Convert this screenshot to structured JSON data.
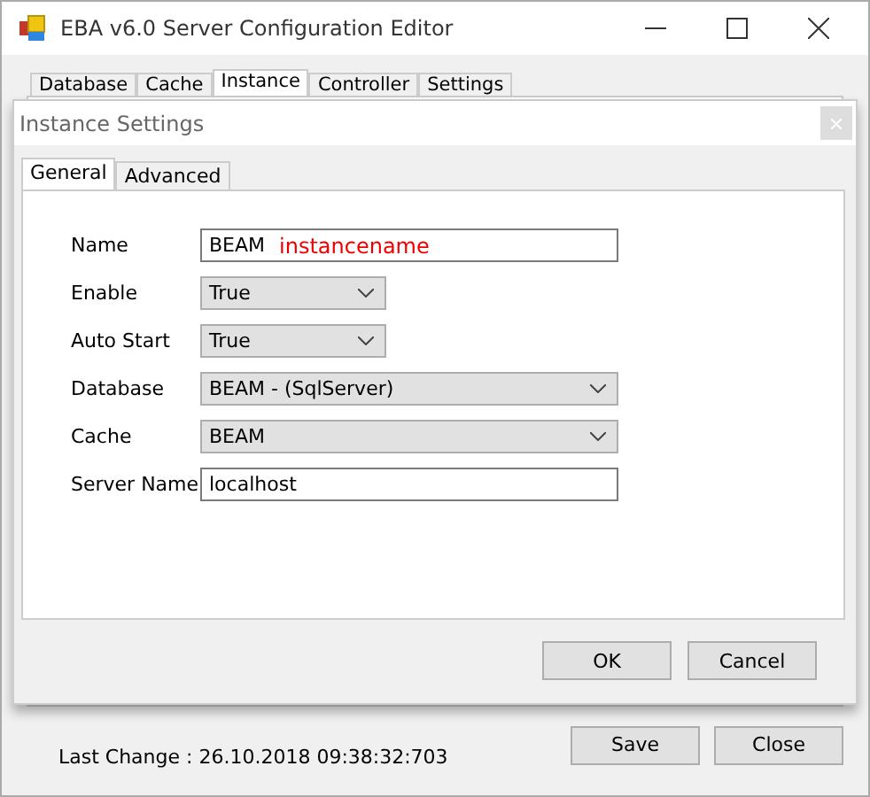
{
  "window": {
    "title": "EBA v6.0 Server Configuration Editor"
  },
  "tabs": [
    {
      "label": "Database",
      "selected": false
    },
    {
      "label": "Cache",
      "selected": false
    },
    {
      "label": "Instance",
      "selected": true
    },
    {
      "label": "Controller",
      "selected": false
    },
    {
      "label": "Settings",
      "selected": false
    }
  ],
  "dialog": {
    "title": "Instance Settings",
    "tabs": [
      {
        "label": "General",
        "selected": true
      },
      {
        "label": "Advanced",
        "selected": false
      }
    ],
    "fields": [
      {
        "label": "Name",
        "kind": "text",
        "value": "BEAM",
        "annotation": "instancename",
        "wide": true
      },
      {
        "label": "Enable",
        "kind": "select",
        "value": "True",
        "wide": false
      },
      {
        "label": "Auto Start",
        "kind": "select",
        "value": "True",
        "wide": false
      },
      {
        "label": "Database",
        "kind": "select",
        "value": "BEAM - (SqlServer)",
        "wide": true
      },
      {
        "label": "Cache",
        "kind": "select",
        "value": "BEAM",
        "wide": true
      },
      {
        "label": "Server Name",
        "kind": "text",
        "value": "localhost",
        "wide": true
      }
    ],
    "buttons": [
      "OK",
      "Cancel"
    ]
  },
  "status": "Last Change : 26.10.2018 09:38:32:703",
  "buttons": [
    "Save",
    "Close"
  ]
}
